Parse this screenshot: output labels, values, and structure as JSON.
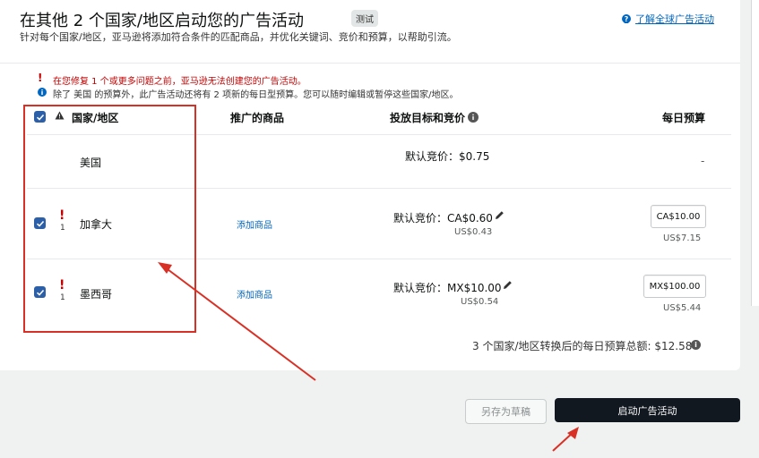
{
  "header": {
    "title": "在其他 2 个国家/地区启动您的广告活动",
    "badge": "测试",
    "subtitle": "针对每个国家/地区，亚马逊将添加符合条件的匹配商品，并优化关键词、竞价和预算，以帮助引流。",
    "learn_more": "了解全球广告活动"
  },
  "alerts": {
    "error": "在您修复 1 个或更多问题之前，亚马逊无法创建您的广告活动。",
    "info": "除了 美国 的预算外，此广告活动还将有 2 项新的每日型预算。您可以随时编辑或暂停这些国家/地区。"
  },
  "table": {
    "headers": {
      "country": "国家/地区",
      "products": "推广的商品",
      "bid": "投放目标和竞价",
      "budget": "每日预算"
    },
    "rows": [
      {
        "country": "美国",
        "bid": "默认竞价：$0.75",
        "budget": "-"
      },
      {
        "issues": "1",
        "country": "加拿大",
        "products_link": "添加商品",
        "bid": "默认竞价：CA$0.60",
        "bid_usd": "US$0.43",
        "budget": "CA$10.00",
        "budget_usd": "US$7.15"
      },
      {
        "issues": "1",
        "country": "墨西哥",
        "products_link": "添加商品",
        "bid": "默认竞价：MX$10.00",
        "bid_usd": "US$0.54",
        "budget": "MX$100.00",
        "budget_usd": "US$5.44"
      }
    ],
    "total": "3 个国家/地区转换后的每日预算总额: $12.58"
  },
  "footer": {
    "save_draft": "另存为草稿",
    "launch": "启动广告活动"
  },
  "colors": {
    "annotation_red": "#d93025",
    "link_blue": "#0066c0",
    "checkbox_blue": "#2b5fa8",
    "launch_bg": "#111820"
  },
  "icons": {
    "info": "info-icon",
    "warning": "warning-triangle-icon",
    "error": "exclamation-icon",
    "edit": "pencil-icon"
  }
}
